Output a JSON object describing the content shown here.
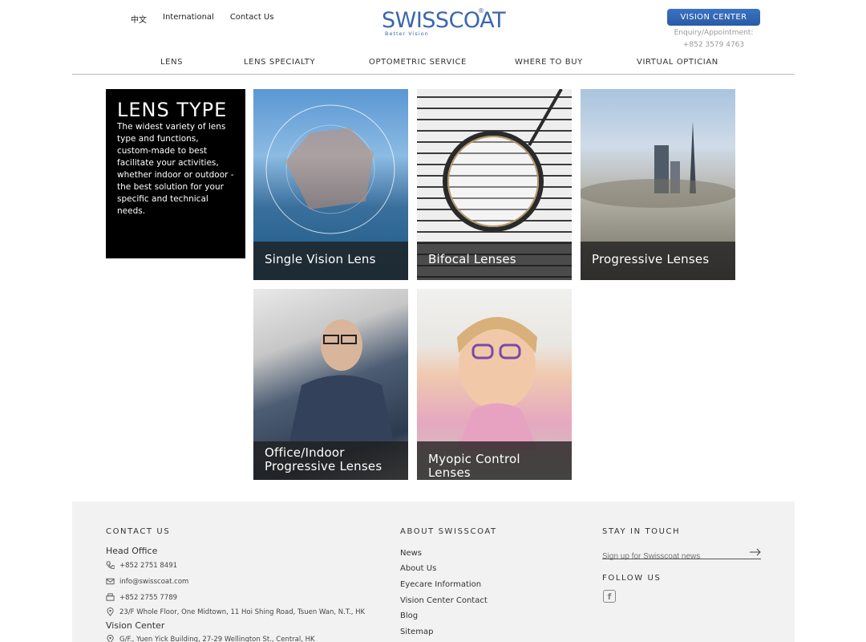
{
  "header": {
    "links": [
      "中文",
      "International",
      "Contact Us"
    ],
    "logo": {
      "name": "SWISSCOAT",
      "tagline": "Better Vision",
      "reg": "®"
    },
    "vision_center_button": "VISION CENTER",
    "enquiry_label": "Enquiry/Appointment:",
    "enquiry_phone": "+852 3579 4763"
  },
  "nav": {
    "items": [
      "LENS",
      "LENS SPECIALTY",
      "OPTOMETRIC SERVICE",
      "WHERE TO BUY",
      "VIRTUAL OPTICIAN"
    ]
  },
  "intro": {
    "title": "LENS TYPE",
    "text": "The widest variety of lens type and functions, custom-made to best facilitate your activities, whether indoor or outdoor - the best solution for your specific and technical needs."
  },
  "tiles": [
    {
      "label": "Single Vision Lens"
    },
    {
      "label": "Bifocal Lenses"
    },
    {
      "label": "Progressive Lenses"
    },
    {
      "label": "Office/Indoor Progressive Lenses"
    },
    {
      "label": "Myopic Control Lenses"
    }
  ],
  "footer": {
    "contact": {
      "title": "CONTACT US",
      "head_office": "Head Office",
      "phone": "+852 2751 8491",
      "email": "info@swisscoat.com",
      "fax": "+852 2755 7789",
      "address": "23/F Whole Floor, One Midtown, 11 Hoi Shing Road, Tsuen Wan, N.T., HK",
      "vision_center": "Vision Center",
      "vision_address": "G/F., Yuen Yick Building, 27-29 Wellington St., Central, HK"
    },
    "about": {
      "title": "ABOUT SWISSCOAT",
      "links": [
        "News",
        "About Us",
        "Eyecare Information",
        "Vision Center Contact",
        "Blog",
        "Sitemap"
      ]
    },
    "touch": {
      "title": "STAY IN TOUCH",
      "placeholder": "Sign up for Swisscoat news",
      "follow": "FOLLOW US"
    }
  }
}
